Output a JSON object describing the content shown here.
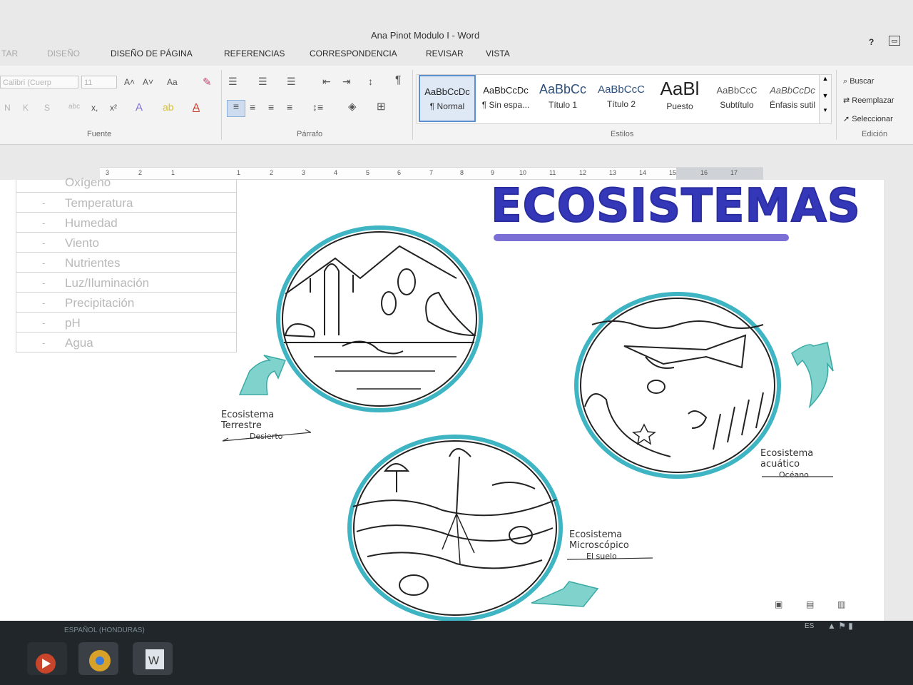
{
  "window": {
    "title": "Ana Pinot Modulo I - Word",
    "help": "?"
  },
  "tabs": [
    "TAR",
    "DISEÑO",
    "DISEÑO DE PÁGINA",
    "REFERENCIAS",
    "CORRESPONDENCIA",
    "REVISAR",
    "VISTA"
  ],
  "ribbon": {
    "font_name": "Calibri (Cuerp",
    "font_size": "11",
    "change_case": "Aa",
    "font_group": "Fuente",
    "paragraph_group": "Párrafo",
    "styles_group": "Estilos",
    "editing_group": "Edición",
    "styles": [
      {
        "preview": "AaBbCcDc",
        "name": "¶ Normal"
      },
      {
        "preview": "AaBbCcDc",
        "name": "¶ Sin espa..."
      },
      {
        "preview": "AaBbCc",
        "name": "Título 1"
      },
      {
        "preview": "AaBbCcC",
        "name": "Título 2"
      },
      {
        "preview": "AaBl",
        "name": "Puesto"
      },
      {
        "preview": "AaBbCcC",
        "name": "Subtítulo"
      },
      {
        "preview": "AaBbCcDc",
        "name": "Énfasis sutil"
      }
    ],
    "editing": {
      "find": "Buscar",
      "replace": "Reemplazar",
      "select": "Seleccionar"
    }
  },
  "ruler": [
    "3",
    "2",
    "1",
    "1",
    "2",
    "3",
    "4",
    "5",
    "6",
    "7",
    "8",
    "9",
    "10",
    "11",
    "12",
    "13",
    "14",
    "15",
    "16",
    "17"
  ],
  "table_rows": [
    "Oxígeno",
    "Temperatura",
    "Humedad",
    "Viento",
    "Nutrientes",
    "Luz/Iluminación",
    "Precipitación",
    "pH",
    "Agua"
  ],
  "drawing": {
    "title": "ECOSISTEMAS",
    "terrestrial": {
      "line1": "Ecosistema",
      "line2": "Terrestre",
      "line3": "Desierto"
    },
    "aquatic": {
      "line1": "Ecosistema",
      "line2": "acuático",
      "line3": "Océano"
    },
    "micro": {
      "line1": "Ecosistema",
      "line2": "Microscópico",
      "line3": "El suelo"
    }
  },
  "statusbar": {
    "language": "ESPAÑOL (HONDURAS)"
  },
  "tray": {
    "lang": "ES"
  }
}
